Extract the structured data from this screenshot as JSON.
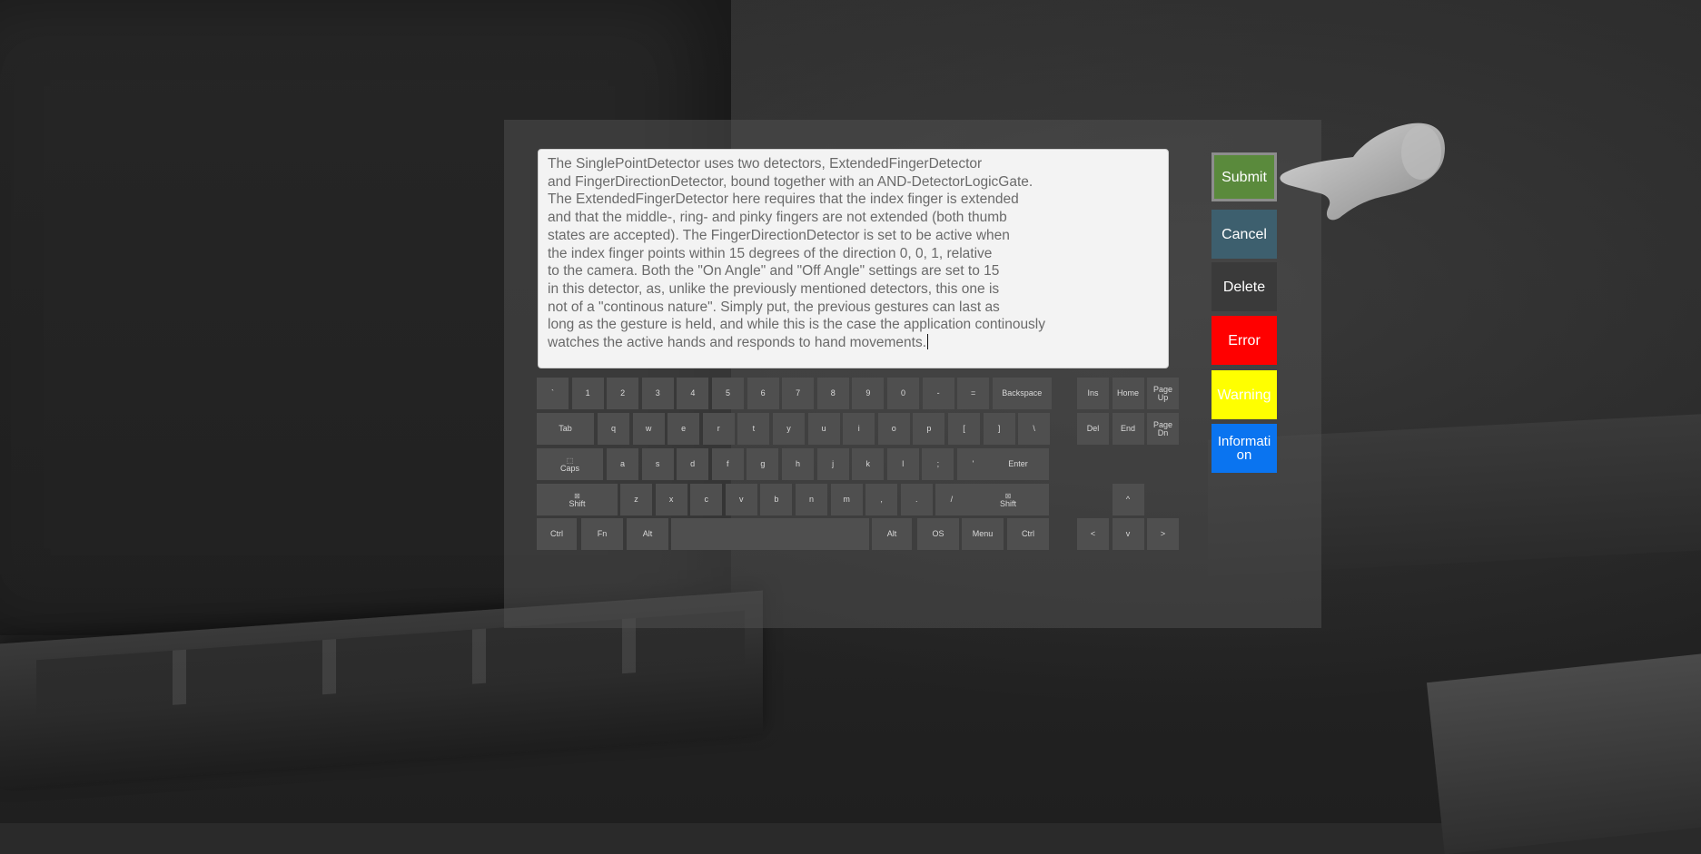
{
  "editor": {
    "text": "The SinglePointDetector uses two detectors, ExtendedFingerDetector\nand FingerDirectionDetector, bound together with an AND-DetectorLogicGate.\nThe ExtendedFingerDetector here requires that the index finger is extended\nand that the middle-, ring- and pinky fingers are not extended (both thumb\nstates are accepted). The FingerDirectionDetector is set to be active when\nthe index finger points within 15 degrees of the direction 0, 0, 1, relative\nto the camera. Both the \"On Angle\" and \"Off Angle\" settings are set to 15\nin this detector, as, unlike the previously mentioned detectors, this one is\nnot of a \"continous nature\". Simply put, the previous gestures can last as\nlong as the gesture is held, and while this is the case the application continously\nwatches the active hands and responds to hand movements."
  },
  "keyboard": {
    "row1": [
      "`",
      "1",
      "2",
      "3",
      "4",
      "5",
      "6",
      "7",
      "8",
      "9",
      "0",
      "-",
      "=",
      "Backspace"
    ],
    "row2": [
      "Tab",
      "q",
      "w",
      "e",
      "r",
      "t",
      "y",
      "u",
      "i",
      "o",
      "p",
      "[",
      "]",
      "\\"
    ],
    "row3": [
      "Caps",
      "a",
      "s",
      "d",
      "f",
      "g",
      "h",
      "j",
      "k",
      "l",
      ";",
      "'",
      "Enter"
    ],
    "row4": [
      "Shift",
      "z",
      "x",
      "c",
      "v",
      "b",
      "n",
      "m",
      ",",
      ".",
      "/",
      "Shift"
    ],
    "row5": [
      "Ctrl",
      "Fn",
      "Alt",
      "",
      "Alt",
      "OS",
      "Menu",
      "Ctrl"
    ],
    "caps_icon": "⬚",
    "shift_icon": "⊠",
    "nav_top": [
      "Ins",
      "Home",
      "Page Up"
    ],
    "nav_mid": [
      "Del",
      "End",
      "Page Dn"
    ],
    "arrows": [
      "^",
      "<",
      "v",
      ">"
    ]
  },
  "actions": {
    "submit": "Submit",
    "cancel": "Cancel",
    "delete": "Delete",
    "error": "Error",
    "warning": "Warning",
    "information": "Information"
  },
  "colors": {
    "submit": "#5a8a3c",
    "cancel": "#3d5f6e",
    "delete": "#3a3a3a",
    "error": "#ff0000",
    "warning": "#ffff00",
    "information": "#0a74f0"
  }
}
